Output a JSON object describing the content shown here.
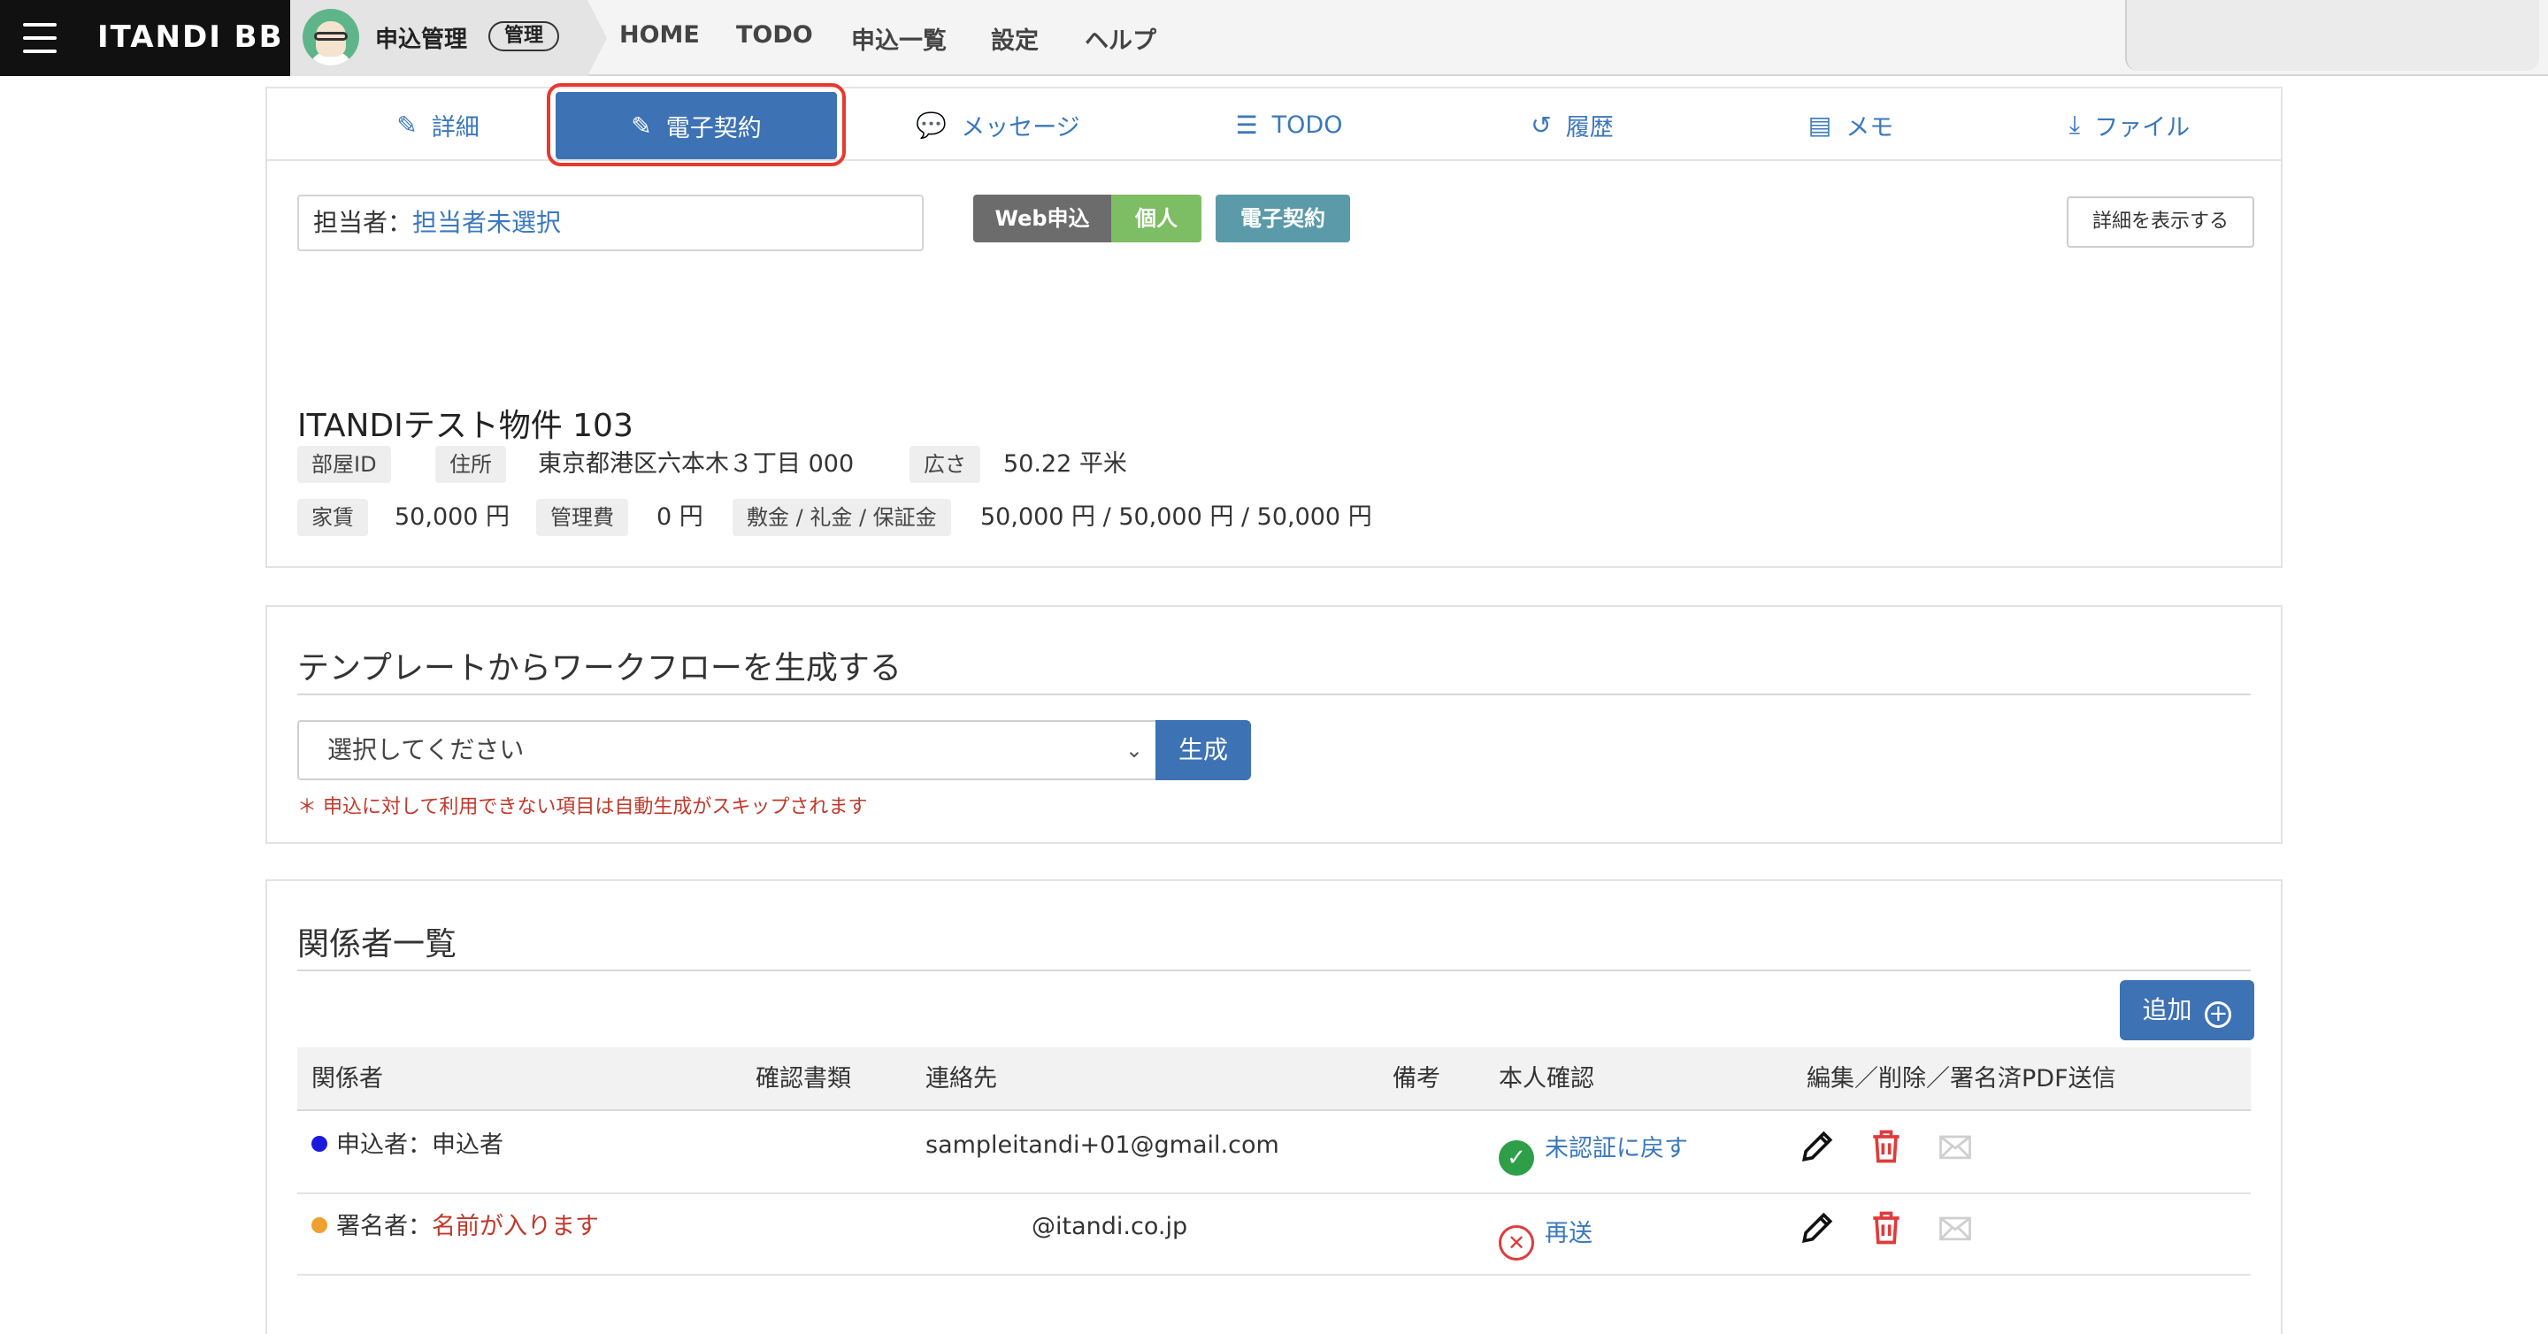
{
  "header": {
    "brand": "ITANDI BB",
    "app_title": "申込管理",
    "role_badge": "管理",
    "nav": [
      {
        "label": "HOME"
      },
      {
        "label": "TODO"
      },
      {
        "label": "申込一覧"
      },
      {
        "label": "設定"
      },
      {
        "label": "ヘルプ"
      }
    ]
  },
  "tabs": [
    {
      "label": "詳細",
      "icon": "edit-icon"
    },
    {
      "label": "電子契約",
      "icon": "edit-icon",
      "active": true
    },
    {
      "label": "メッセージ",
      "icon": "chat-icon"
    },
    {
      "label": "TODO",
      "icon": "list-icon"
    },
    {
      "label": "履歴",
      "icon": "history-icon"
    },
    {
      "label": "メモ",
      "icon": "memo-icon"
    },
    {
      "label": "ファイル",
      "icon": "download-icon"
    }
  ],
  "application": {
    "assignee_label": "担当者：",
    "assignee_value": "担当者未選択",
    "badges": [
      {
        "label": "Web申込",
        "color": "#6c6c6c"
      },
      {
        "label": "個人",
        "color": "#7dbd64"
      },
      {
        "label": "電子契約",
        "color": "#5b9aa8"
      }
    ],
    "show_detail_button": "詳細を表示する"
  },
  "property": {
    "name": "ITANDIテスト物件 103",
    "room_id_label": "部屋ID",
    "room_id_value": "",
    "address_label": "住所",
    "address_value": "東京都港区六本木３丁目 000",
    "area_label": "広さ",
    "area_value": "50.22 平米",
    "rent_label": "家賃",
    "rent_value": "50,000 円",
    "mgmt_fee_label": "管理費",
    "mgmt_fee_value": "0 円",
    "deposit_label": "敷金 / 礼金 / 保証金",
    "deposit_value": "50,000 円 / 50,000 円 / 50,000 円"
  },
  "workflow": {
    "title": "テンプレートからワークフローを生成する",
    "select_placeholder": "選択してください",
    "generate_button": "生成",
    "note": "＊ 申込に対して利用できない項目は自動生成がスキップされます"
  },
  "parties": {
    "title": "関係者一覧",
    "add_button": "追加",
    "columns": [
      "関係者",
      "確認書類",
      "連絡先",
      "備考",
      "本人確認",
      "編集／削除／署名済PDF送信"
    ],
    "rows": [
      {
        "role": "申込者",
        "separator": "：",
        "name": "申込者",
        "dot_color": "#1a1adb",
        "contact": "sampleitandi+01@gmail.com",
        "note": "",
        "verify_status": "ok",
        "verify_link": "未認証に戻す"
      },
      {
        "role": "署名者",
        "separator": "：",
        "name": "名前が入ります",
        "dot_color": "#f0a030",
        "contact": "@itandi.co.jp",
        "note": "",
        "verify_status": "ng",
        "verify_link": "再送"
      }
    ]
  },
  "colors": {
    "accent": "#3d72b4",
    "link": "#3a78bd",
    "highlight": "#e8392e",
    "danger": "#e03b3b"
  }
}
